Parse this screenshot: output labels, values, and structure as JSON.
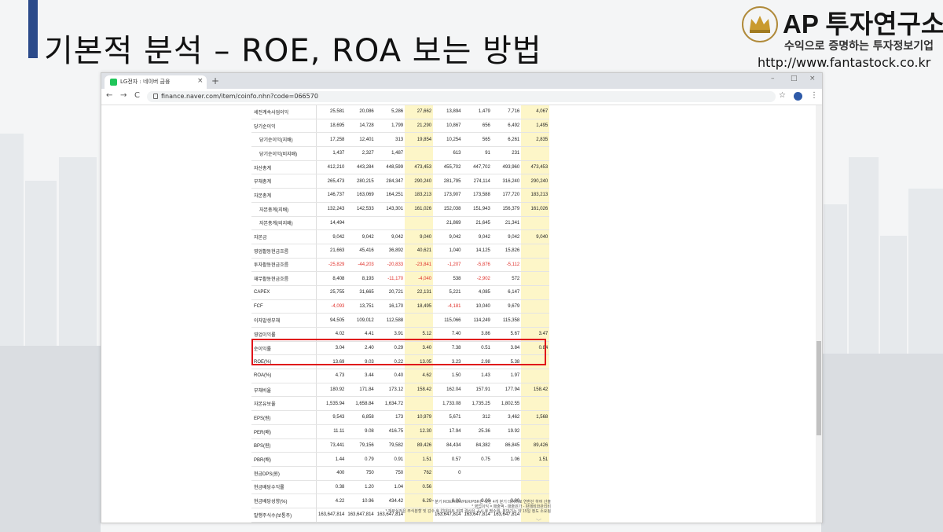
{
  "slide": {
    "title": "기본적 분석 – ROE, ROA 보는 방법",
    "accent_color": "#2b4a8a"
  },
  "logo": {
    "name": "AP 투자연구소",
    "tagline": "수익으로 증명하는 투자정보기업",
    "url": "http://www.fantastock.co.kr",
    "icon": "crown-icon"
  },
  "browser": {
    "tab_title": "LG전자 : 네이버 금융",
    "tab_close": "×",
    "new_tab": "+",
    "window_buttons": [
      "–",
      "□",
      "×"
    ],
    "nav": [
      "←",
      "→",
      "C"
    ],
    "url": "finance.naver.com/item/coinfo.nhn?code=066570",
    "star": "☆",
    "menu": "⋮"
  },
  "table": {
    "highlight_columns": [
      3,
      7
    ],
    "rows": [
      {
        "label": "세전계속사업이익",
        "sub": false,
        "values": [
          "25,581",
          "20,086",
          "5,286",
          "27,662",
          "13,894",
          "1,479",
          "7,716",
          "4,067"
        ]
      },
      {
        "label": "당기순이익",
        "sub": false,
        "values": [
          "18,695",
          "14,728",
          "1,799",
          "21,290",
          "10,867",
          "656",
          "6,492",
          "1,495"
        ]
      },
      {
        "label": "당기순이익(지배)",
        "sub": true,
        "values": [
          "17,258",
          "12,401",
          "313",
          "19,854",
          "10,254",
          "565",
          "6,261",
          "2,835"
        ]
      },
      {
        "label": "당기순이익(비지배)",
        "sub": true,
        "values": [
          "1,437",
          "2,327",
          "1,487",
          "",
          "613",
          "91",
          "231",
          ""
        ]
      },
      {
        "label": "자산총계",
        "sub": false,
        "values": [
          "412,210",
          "443,284",
          "448,599",
          "473,453",
          "455,702",
          "447,702",
          "493,960",
          "473,453"
        ]
      },
      {
        "label": "부채총계",
        "sub": false,
        "values": [
          "265,473",
          "280,215",
          "284,347",
          "290,240",
          "281,795",
          "274,114",
          "316,240",
          "290,240"
        ]
      },
      {
        "label": "자본총계",
        "sub": false,
        "values": [
          "146,737",
          "163,069",
          "164,251",
          "183,213",
          "173,907",
          "173,588",
          "177,720",
          "183,213"
        ]
      },
      {
        "label": "자본총계(지배)",
        "sub": true,
        "values": [
          "132,243",
          "142,533",
          "143,301",
          "161,026",
          "152,038",
          "151,943",
          "156,379",
          "161,026"
        ]
      },
      {
        "label": "자본총계(비지배)",
        "sub": true,
        "values": [
          "14,494",
          "",
          "",
          "",
          "21,869",
          "21,645",
          "21,341",
          ""
        ]
      },
      {
        "label": "자본금",
        "sub": false,
        "values": [
          "9,042",
          "9,042",
          "9,042",
          "9,040",
          "9,042",
          "9,042",
          "9,042",
          "9,040"
        ]
      },
      {
        "label": "영업활동현금흐름",
        "sub": false,
        "values": [
          "21,663",
          "45,416",
          "36,892",
          "40,621",
          "1,040",
          "14,125",
          "15,826",
          ""
        ]
      },
      {
        "label": "투자활동현금흐름",
        "sub": false,
        "negative": true,
        "values": [
          "-25,829",
          "-44,203",
          "-20,833",
          "-23,841",
          "-1,207",
          "-5,876",
          "-5,112",
          ""
        ]
      },
      {
        "label": "재무활동현금흐름",
        "sub": false,
        "values": [
          "8,408",
          "8,193",
          "-11,170",
          "-4,040",
          "538",
          "-2,902",
          "572",
          ""
        ]
      },
      {
        "label": "CAPEX",
        "sub": false,
        "values": [
          "25,755",
          "31,665",
          "20,721",
          "22,131",
          "5,221",
          "4,085",
          "6,147",
          ""
        ]
      },
      {
        "label": "FCF",
        "sub": false,
        "values": [
          "-4,093",
          "13,751",
          "16,170",
          "18,495",
          "-4,181",
          "10,040",
          "9,679",
          ""
        ]
      },
      {
        "label": "이자발생부채",
        "sub": false,
        "values": [
          "94,505",
          "109,012",
          "112,588",
          "",
          "115,066",
          "114,249",
          "115,358",
          ""
        ]
      },
      {
        "label": "영업이익률",
        "sub": false,
        "values": [
          "4.02",
          "4.41",
          "3.91",
          "5.12",
          "7.40",
          "3.86",
          "5.67",
          "3.47"
        ]
      },
      {
        "label": "순이익률",
        "sub": false,
        "values": [
          "3.04",
          "2.40",
          "0.29",
          "3.40",
          "7.38",
          "0.51",
          "3.84",
          "0.84"
        ]
      },
      {
        "label": "ROE(%)",
        "sub": false,
        "values": [
          "13.69",
          "9.03",
          "0.22",
          "13.05",
          "3.23",
          "2.98",
          "5.38",
          ""
        ]
      },
      {
        "label": "ROA(%)",
        "sub": false,
        "values": [
          "4.73",
          "3.44",
          "0.40",
          "4.62",
          "1.50",
          "1.43",
          "1.97",
          ""
        ]
      },
      {
        "label": "부채비율",
        "sub": false,
        "values": [
          "180.92",
          "171.84",
          "173.12",
          "158.42",
          "162.04",
          "157.91",
          "177.94",
          "158.42"
        ]
      },
      {
        "label": "자본유보율",
        "sub": false,
        "values": [
          "1,535.94",
          "1,658.84",
          "1,634.72",
          "",
          "1,733.08",
          "1,735.25",
          "1,802.55",
          ""
        ]
      },
      {
        "label": "EPS(원)",
        "sub": false,
        "values": [
          "9,543",
          "6,858",
          "173",
          "10,979",
          "5,671",
          "312",
          "3,462",
          "1,568"
        ]
      },
      {
        "label": "PER(배)",
        "sub": false,
        "values": [
          "11.11",
          "9.08",
          "416.75",
          "12.30",
          "17.94",
          "25.36",
          "19.92",
          ""
        ]
      },
      {
        "label": "BPS(원)",
        "sub": false,
        "values": [
          "73,441",
          "79,156",
          "79,582",
          "89,426",
          "84,434",
          "84,382",
          "86,845",
          "89,426"
        ]
      },
      {
        "label": "PBR(배)",
        "sub": false,
        "values": [
          "1.44",
          "0.79",
          "0.91",
          "1.51",
          "0.57",
          "0.75",
          "1.06",
          "1.51"
        ]
      },
      {
        "label": "현금DPS(원)",
        "sub": false,
        "values": [
          "400",
          "750",
          "750",
          "762",
          "0",
          "",
          "",
          ""
        ]
      },
      {
        "label": "현금배당수익률",
        "sub": false,
        "values": [
          "0.38",
          "1.20",
          "1.04",
          "0.56",
          "",
          "",
          "",
          ""
        ]
      },
      {
        "label": "현금배당성향(%)",
        "sub": false,
        "values": [
          "4.22",
          "10.96",
          "434.42",
          "6.29",
          "0.00",
          "0.00",
          "0.00",
          ""
        ]
      },
      {
        "label": "발행주식수(보통주)",
        "sub": false,
        "values": [
          "163,647,814",
          "163,647,814",
          "163,647,814",
          "",
          "163,647,814",
          "163,647,814",
          "163,647,814",
          ""
        ]
      }
    ],
    "negative_cells": [
      [
        11,
        0
      ],
      [
        11,
        1
      ],
      [
        11,
        2
      ],
      [
        11,
        3
      ],
      [
        11,
        4
      ],
      [
        11,
        5
      ],
      [
        11,
        6
      ],
      [
        12,
        2
      ],
      [
        12,
        3
      ],
      [
        12,
        5
      ],
      [
        14,
        0
      ],
      [
        14,
        4
      ]
    ]
  },
  "footnotes": [
    "* 분기 ROE/ROA/PER/PBR은 직전 4개 분기 데이터로 연환산 하여 산출",
    "* 영업이익 = 매출액 - 매출원가 - 판매비와관리비",
    "* 재무실적은 주식분할 및 감수 후 업데이트 되며 결산은 공시 후 필수월, 분반기는 약 15일 정도 소요됨"
  ],
  "colors": {
    "highlight": "#fdf6c8",
    "negative": "#e0312b",
    "box": "#e0141a"
  }
}
